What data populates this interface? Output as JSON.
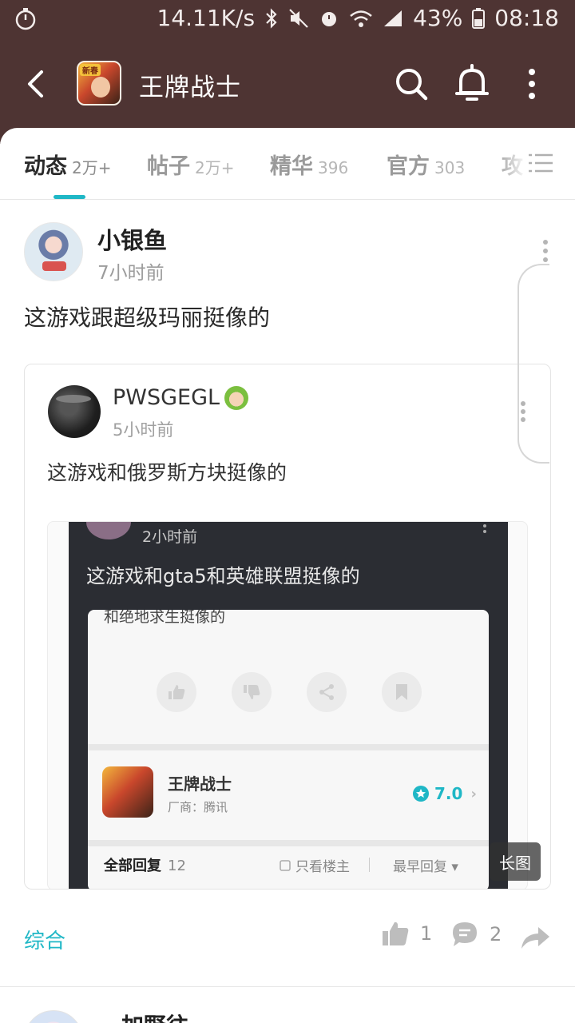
{
  "status_bar": {
    "speed": "14.11K/s",
    "battery": "43%",
    "time": "08:18"
  },
  "header": {
    "title": "王牌战士",
    "icon_tag": "新春"
  },
  "tabs": [
    {
      "label": "动态",
      "count": "2万+",
      "active": true
    },
    {
      "label": "帖子",
      "count": "2万+"
    },
    {
      "label": "精华",
      "count": "396"
    },
    {
      "label": "官方",
      "count": "303"
    },
    {
      "label": "攻",
      "count": ""
    }
  ],
  "post": {
    "author": "小银鱼",
    "time": "7小时前",
    "text": "这游戏跟超级玛丽挺像的",
    "quote": {
      "author": "PWSGEGL",
      "time": "5小时前",
      "text": "这游戏和俄罗斯方块挺像的",
      "image": {
        "time": "2小时前",
        "text": "这游戏和gta5和英雄联盟挺像的",
        "card_text": "和绝地求生挺像的",
        "game_name": "王牌战士",
        "vendor": "厂商：腾讯",
        "score": "7.0",
        "replies_label": "全部回复",
        "replies_count": "12",
        "only_op": "只看楼主",
        "sort": "最早回复"
      },
      "long_image_badge": "长图"
    },
    "footer": {
      "tag": "综合",
      "likes": "1",
      "comments": "2"
    }
  },
  "next_post": {
    "author": "加野往"
  },
  "colors": {
    "header_bg": "#4e3433",
    "accent": "#1fb7c6"
  }
}
